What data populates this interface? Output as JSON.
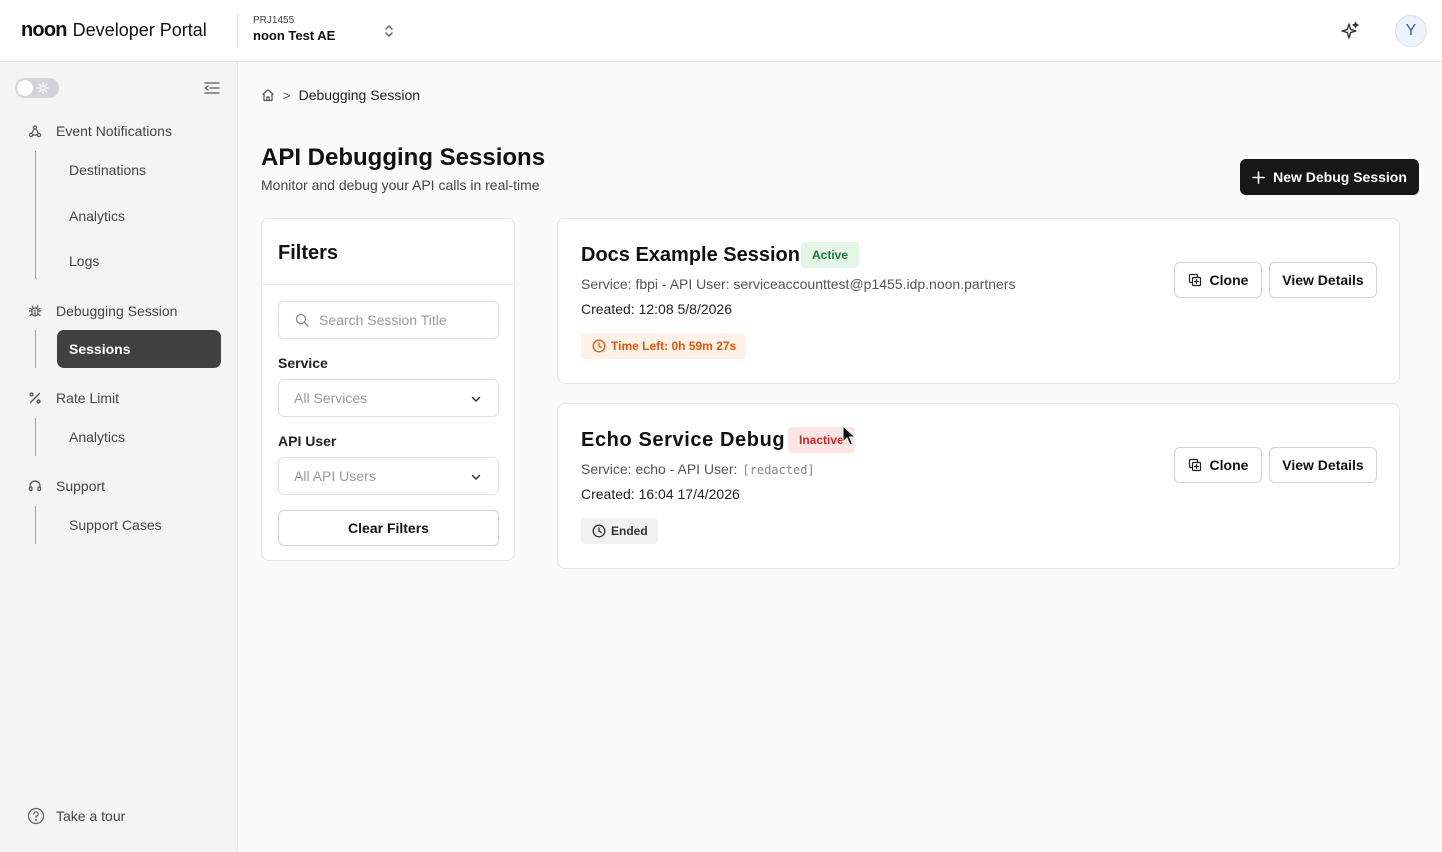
{
  "header": {
    "brand_logo": "noon",
    "brand_text": "Developer Portal",
    "project_id": "PRJ1455",
    "project_name": "noon Test AE",
    "avatar_initial": "Y"
  },
  "sidebar": {
    "groups": [
      {
        "label": "Event Notifications",
        "icon": "webhook-icon",
        "items": [
          "Destinations",
          "Analytics",
          "Logs"
        ]
      },
      {
        "label": "Debugging Session",
        "icon": "bug-icon",
        "items": [
          "Sessions"
        ],
        "active_item": "Sessions"
      },
      {
        "label": "Rate Limit",
        "icon": "percent-icon",
        "items": [
          "Analytics"
        ]
      },
      {
        "label": "Support",
        "icon": "headset-icon",
        "items": [
          "Support Cases"
        ]
      }
    ],
    "tour_label": "Take a tour"
  },
  "breadcrumb": {
    "separator": ">",
    "current": "Debugging Session"
  },
  "page": {
    "title": "API Debugging Sessions",
    "subtitle": "Monitor and debug your API calls in real-time",
    "new_button": "New Debug Session"
  },
  "filters": {
    "title": "Filters",
    "search_placeholder": "Search Session Title",
    "service_label": "Service",
    "service_value": "All Services",
    "api_user_label": "API User",
    "api_user_value": "All API Users",
    "clear_button": "Clear Filters"
  },
  "sessions": [
    {
      "title": "Docs Example Session",
      "status": "Active",
      "service_text": "Service: fbpi - API User: serviceaccounttest@p1455.idp.noon.partners",
      "api_user_redacted": "",
      "created": "Created: 12:08 5/8/2026",
      "timer": "Time Left: 0h 59m 27s",
      "clone_label": "Clone",
      "view_label": "View Details"
    },
    {
      "title": "Echo Service Debug",
      "status": "Inactive",
      "service_text": "Service: echo - API User:",
      "api_user_redacted": "[redacted]",
      "created": "Created: 16:04 17/4/2026",
      "timer": "Ended",
      "clone_label": "Clone",
      "view_label": "View Details"
    }
  ],
  "colors": {
    "primary": "#171717",
    "sidebar_active": "#404040",
    "active_badge_bg": "#e3f6e8",
    "active_badge_text": "#1e7a3c",
    "inactive_badge_bg": "#fde5e5",
    "inactive_badge_text": "#c62828",
    "timer_bg": "#fff1e6",
    "timer_text": "#e2560a"
  }
}
